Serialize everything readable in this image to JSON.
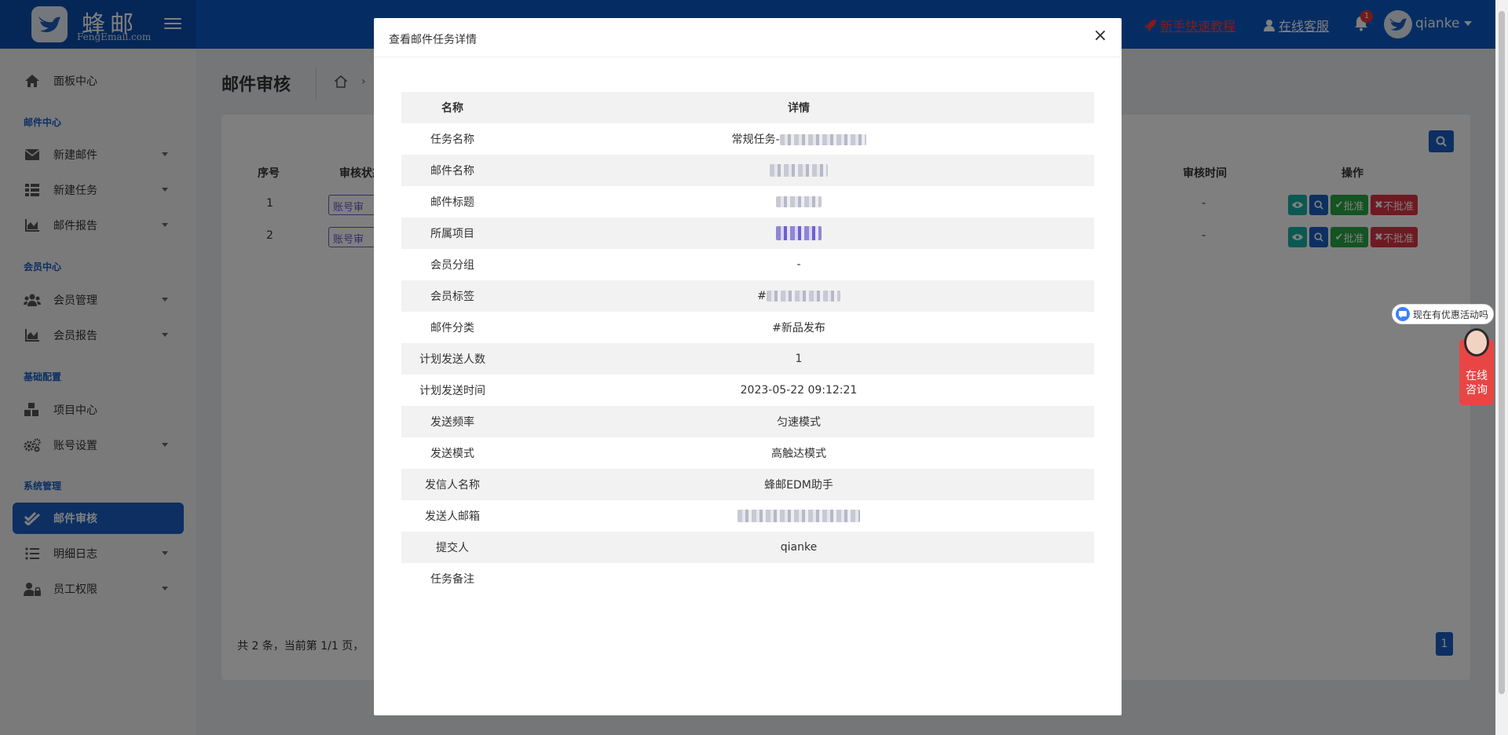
{
  "header": {
    "logo_title": "蜂邮",
    "logo_sub": "FengEmail.com",
    "tutorial_label": "新手快速教程",
    "service_label": "在线客服",
    "bell_count": "1",
    "username": "qianke"
  },
  "sidebar": {
    "dashboard": "面板中心",
    "sections": {
      "mail": "邮件中心",
      "member": "会员中心",
      "config": "基础配置",
      "system": "系统管理"
    },
    "items": {
      "new_mail": "新建邮件",
      "new_task": "新建任务",
      "mail_report": "邮件报告",
      "member_manage": "会员管理",
      "member_report": "会员报告",
      "project_center": "项目中心",
      "account_settings": "账号设置",
      "mail_review": "邮件审核",
      "detail_log": "明细日志",
      "staff_permission": "员工权限"
    }
  },
  "main": {
    "page_title": "邮件审核",
    "table": {
      "headers": {
        "index": "序号",
        "status": "审核状态",
        "review_time": "审核时间",
        "action": "操作"
      },
      "rows": [
        {
          "index": "1",
          "status": "账号审核",
          "review_time": "-"
        },
        {
          "index": "2",
          "status": "账号审核",
          "review_time": "-"
        }
      ],
      "actions": {
        "approve": "批准",
        "reject": "不批准"
      }
    },
    "footer_info": "共 2 条，当前第 1/1 页，",
    "current_page": "1"
  },
  "chat": {
    "promo": "现在有优惠活动吗",
    "consult_line1": "在线",
    "consult_line2": "咨询"
  },
  "modal": {
    "title": "查看邮件任务详情",
    "close": "×",
    "col_name": "名称",
    "col_detail": "详情",
    "rows": {
      "task_name": {
        "label": "任务名称",
        "value_prefix": "常规任务-"
      },
      "mail_name": {
        "label": "邮件名称"
      },
      "mail_subject": {
        "label": "邮件标题"
      },
      "project": {
        "label": "所属项目"
      },
      "member_group": {
        "label": "会员分组",
        "value": "-"
      },
      "member_tag": {
        "label": "会员标签",
        "value_prefix": "#"
      },
      "mail_category": {
        "label": "邮件分类",
        "value": "#新品发布"
      },
      "planned_count": {
        "label": "计划发送人数",
        "value": "1"
      },
      "planned_time": {
        "label": "计划发送时间",
        "value": "2023-05-22 09:12:21"
      },
      "frequency": {
        "label": "发送频率",
        "value": "匀速模式"
      },
      "send_mode": {
        "label": "发送模式",
        "value": "高触达模式"
      },
      "sender_name": {
        "label": "发信人名称",
        "value": "蜂邮EDM助手"
      },
      "sender_email": {
        "label": "发送人邮箱"
      },
      "submitter": {
        "label": "提交人",
        "value": "qianke"
      },
      "task_note": {
        "label": "任务备注",
        "value": ""
      }
    }
  }
}
